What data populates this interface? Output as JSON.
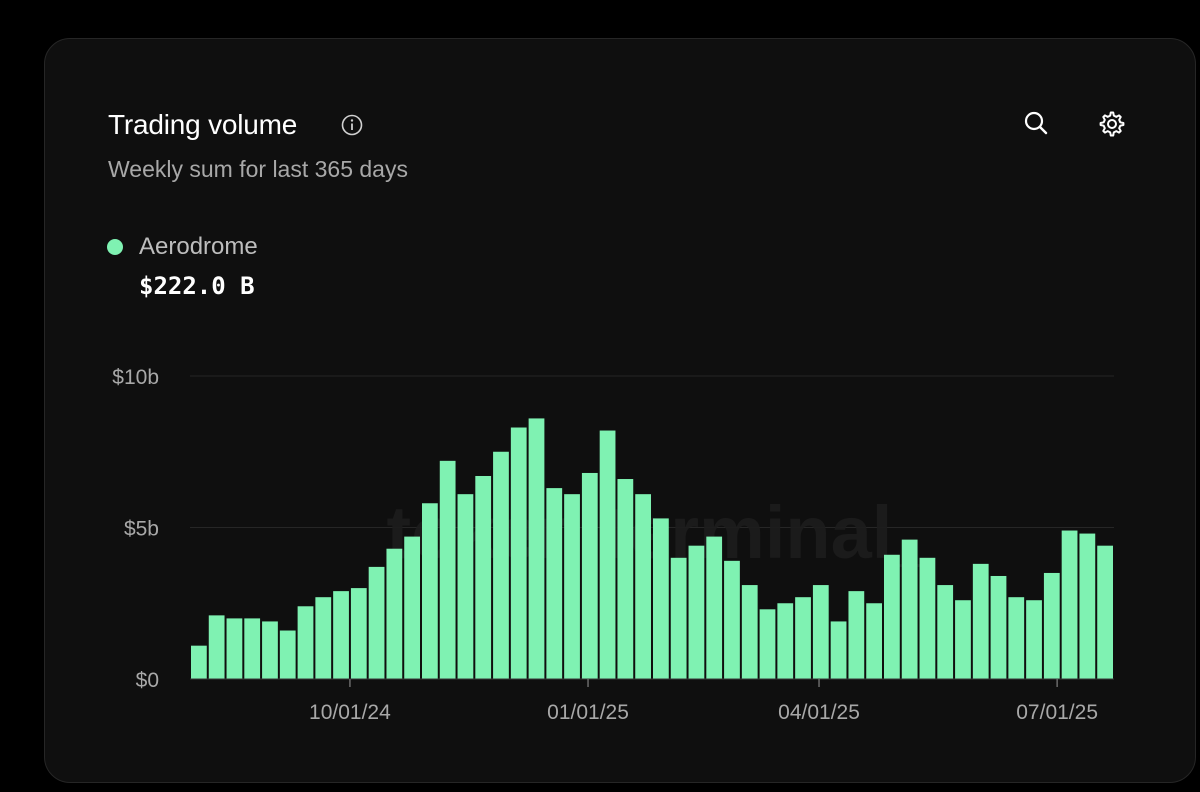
{
  "header": {
    "title": "Trading volume",
    "subtitle": "Weekly sum for last 365 days",
    "info_icon": "info-circle-icon",
    "actions": [
      {
        "name": "search",
        "icon": "search-icon"
      },
      {
        "name": "settings",
        "icon": "gear-icon"
      }
    ]
  },
  "legend": {
    "label": "Aerodrome",
    "value": "$222.0 B",
    "color": "#7ff2b2"
  },
  "watermark": "token terminal_",
  "colors": {
    "bar": "#7ff2b2",
    "background": "#0f0f0f",
    "grid": "#262626",
    "tick_text": "#a8a8a8"
  },
  "chart_data": {
    "type": "bar",
    "unit": "USD billions",
    "ylim": [
      0,
      10
    ],
    "y_ticks": [
      {
        "value": 0,
        "label": "$0"
      },
      {
        "value": 5,
        "label": "$5b"
      },
      {
        "value": 10,
        "label": "$10b"
      }
    ],
    "x_ticks": [
      {
        "index": 4.5,
        "label": "10/01/24"
      },
      {
        "index": 11.2,
        "label": "01/01/25"
      },
      {
        "index": 17.7,
        "label": "04/01/25"
      },
      {
        "index": 24.4,
        "label": "07/01/25"
      }
    ],
    "grid": true,
    "series": [
      {
        "name": "Aerodrome",
        "values": [
          1.1,
          2.1,
          2.0,
          2.0,
          1.9,
          1.6,
          2.4,
          2.7,
          2.9,
          3.0,
          3.7,
          4.3,
          4.7,
          5.8,
          7.2,
          6.1,
          6.7,
          7.5,
          8.3,
          8.6,
          6.3,
          6.1,
          6.8,
          8.2,
          6.6,
          6.1,
          5.3,
          4.0,
          4.4,
          4.7,
          3.9,
          3.1,
          2.3,
          2.5,
          2.7,
          3.1,
          1.9,
          2.9,
          2.5,
          4.1,
          4.6,
          4.0,
          3.1,
          2.6,
          3.8,
          3.4,
          2.7,
          2.6,
          3.5,
          4.9,
          4.8,
          4.4
        ]
      }
    ]
  }
}
